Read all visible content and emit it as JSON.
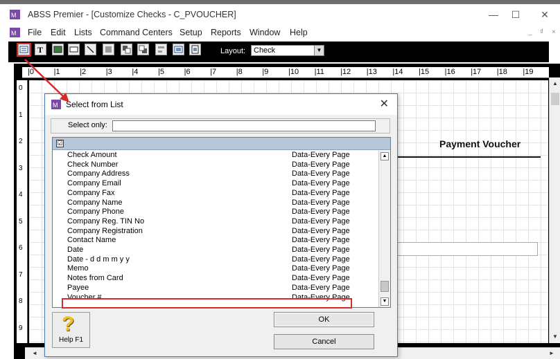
{
  "window": {
    "title": "ABSS Premier - [Customize Checks - C_PVOUCHER]",
    "minimize": "—",
    "maximize": "☐",
    "close": "✕"
  },
  "menu": {
    "items": [
      "File",
      "Edit",
      "Lists",
      "Command Centers",
      "Setup",
      "Reports",
      "Window",
      "Help"
    ],
    "mdi": [
      "_",
      "₫",
      "×"
    ]
  },
  "toolbar": {
    "layout_label": "Layout:",
    "layout_value": "Check",
    "icons": [
      "select-list-icon",
      "text-icon",
      "picture-icon",
      "rectangle-icon",
      "line-icon",
      "field-icon",
      "bring-forward-icon",
      "send-backward-icon",
      "align-icon",
      "grid-icon",
      "page-icon"
    ]
  },
  "ruler": {
    "top": [
      "|0",
      "|1",
      "|2",
      "|3",
      "|4",
      "|5",
      "|6",
      "|7",
      "|8",
      "|9",
      "|10",
      "|11",
      "|12",
      "|13",
      "|14",
      "|15",
      "|16",
      "|17",
      "|18",
      "|19"
    ],
    "left": [
      "0",
      "1",
      "2",
      "3",
      "4",
      "5",
      "6",
      "7",
      "8",
      "9"
    ]
  },
  "canvas": {
    "heading": "Payment Voucher"
  },
  "dialog": {
    "title": "Select from List",
    "close": "✕",
    "select_only_label": "Select only:",
    "select_only_value": "",
    "rows": [
      {
        "name": "Check Amount",
        "type": "Data-Every Page"
      },
      {
        "name": "Check Number",
        "type": "Data-Every Page"
      },
      {
        "name": "Company Address",
        "type": "Data-Every Page"
      },
      {
        "name": "Company Email",
        "type": "Data-Every Page"
      },
      {
        "name": "Company Fax",
        "type": "Data-Every Page"
      },
      {
        "name": "Company Name",
        "type": "Data-Every Page"
      },
      {
        "name": "Company Phone",
        "type": "Data-Every Page"
      },
      {
        "name": "Company Reg. TIN No",
        "type": "Data-Every Page"
      },
      {
        "name": "Company Registration",
        "type": "Data-Every Page"
      },
      {
        "name": "Contact Name",
        "type": "Data-Every Page"
      },
      {
        "name": "Date",
        "type": "Data-Every Page"
      },
      {
        "name": "Date - d d m m y y",
        "type": "Data-Every Page"
      },
      {
        "name": "Memo",
        "type": "Data-Every Page"
      },
      {
        "name": "Notes from Card",
        "type": "Data-Every Page"
      },
      {
        "name": "Payee",
        "type": "Data-Every Page"
      },
      {
        "name": "Voucher #",
        "type": "Data-Every Page"
      }
    ],
    "help_label": "Help F1",
    "ok_label": "OK",
    "cancel_label": "Cancel"
  },
  "colors": {
    "highlight": "#d42b2b",
    "list_header": "#b7c7da"
  }
}
